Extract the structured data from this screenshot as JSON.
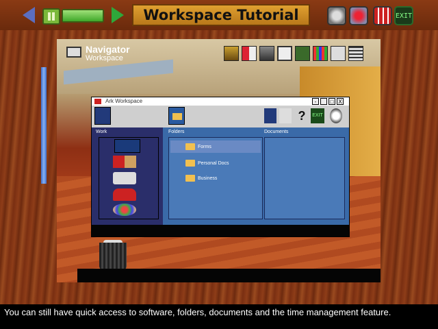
{
  "app": {
    "title": "Workspace Tutorial",
    "progress_fraction": 1.0
  },
  "controls": {
    "back_icon": "left-arrow-icon",
    "pause_icon": "pause-icon",
    "forward_icon": "right-arrow-icon",
    "top_icons": [
      "clock-icon",
      "help-icon",
      "grid-icon",
      "exit-icon"
    ],
    "exit_label": "EXIT"
  },
  "navigator": {
    "title": "Navigator",
    "subtitle": "Workspace",
    "toolbar_icons": [
      "door-icon",
      "phone-icon",
      "remote-icon",
      "calculator-icon",
      "runner-icon",
      "palette-icon",
      "note-icon",
      "grid-view-icon"
    ]
  },
  "window": {
    "title": "Ark Workspace",
    "controls": [
      "-",
      "_",
      "□",
      "X"
    ],
    "header_icons": [
      "work-icon",
      "folder-icon",
      "door-icon",
      "runner-icon",
      "help-icon",
      "exit-icon",
      "clock-icon"
    ],
    "exit_label": "EXIT",
    "help_label": "?",
    "work_label": "Work",
    "folders_label": "Folders",
    "documents_label": "Documents",
    "folders": [
      {
        "label": "Forms",
        "selected": true
      },
      {
        "label": "Personal Docs",
        "selected": false
      },
      {
        "label": "Business",
        "selected": false
      }
    ],
    "work_items": [
      "workspace-item-icon",
      "books-icon",
      "phone-card-icon",
      "telephone-icon",
      "palette-icon"
    ]
  },
  "caption": {
    "text": "You can still have quick access to software, folders, documents and the time management feature."
  }
}
